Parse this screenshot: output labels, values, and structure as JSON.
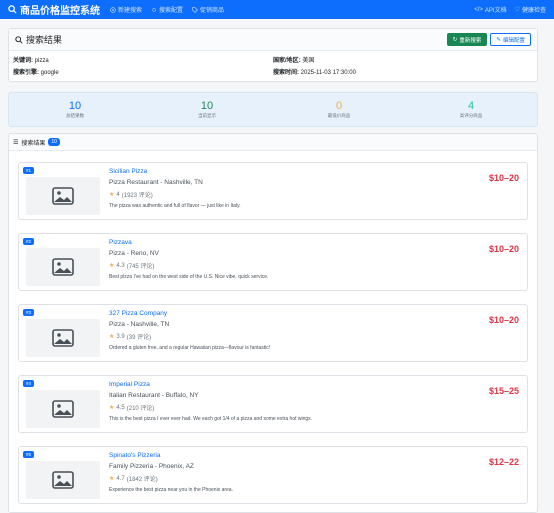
{
  "nav": {
    "brand": "商品价格监控系统",
    "links": [
      "新建搜索",
      "搜索配置",
      "促销商品"
    ],
    "right": [
      "API文档",
      "健康检查"
    ]
  },
  "search": {
    "title": "搜索结果",
    "refresh_label": "重新搜索",
    "edit_label": "编辑配置",
    "keyword_label": "关键词:",
    "keyword": "pizza",
    "country_label": "国家/地区:",
    "country": "美国",
    "engine_label": "搜索引擎:",
    "engine": "google",
    "time_label": "搜索时间:",
    "time": "2025-11-03 17:30:00"
  },
  "stats": [
    {
      "value": "10",
      "label": "总结果数",
      "color": "#0d6efd"
    },
    {
      "value": "10",
      "label": "当前显示",
      "color": "#198754"
    },
    {
      "value": "0",
      "label": "最低价商品",
      "color": "#f0ad4e"
    },
    {
      "value": "4",
      "label": "高评分商品",
      "color": "#20c997"
    }
  ],
  "results": {
    "title": "搜索结果",
    "count": "10",
    "items": [
      {
        "rank": "#1",
        "name": "Sicilian Pizza",
        "type": "Pizza Restaurant - Nashville, TN",
        "rating": "4",
        "reviews": "(1923 评论)",
        "review": "The pizza was authentic and full of flavor — just like in Italy.",
        "price": "$10–20"
      },
      {
        "rank": "#2",
        "name": "Pizzava",
        "type": "Pizza - Reno, NV",
        "rating": "4.3",
        "reviews": "(745 评论)",
        "review": "Best pizza I've had on the west side of the U.S. Nice vibe, quick service.",
        "price": "$10–20"
      },
      {
        "rank": "#3",
        "name": "327 Pizza Company",
        "type": "Pizza - Nashville, TN",
        "rating": "3.9",
        "reviews": "(39 评论)",
        "review": "Ordered a gluten free, and a regular Hawaiian pizza—flavour is fantastic!",
        "price": "$10–20"
      },
      {
        "rank": "#4",
        "name": "Imperial Pizza",
        "type": "Italian Restaurant - Buffalo, NY",
        "rating": "4.5",
        "reviews": "(210 评论)",
        "review": "This is the best pizza I ever ever had. We each got 1/4 of a pizza and some extra hot wings.",
        "price": "$15–25"
      },
      {
        "rank": "#5",
        "name": "Spinato's Pizzeria",
        "type": "Family Pizzeria - Phoenix, AZ",
        "rating": "4.7",
        "reviews": "(1842 评论)",
        "review": "Experience the best pizza near you in the Phoenix area.",
        "price": "$12–22"
      }
    ]
  }
}
